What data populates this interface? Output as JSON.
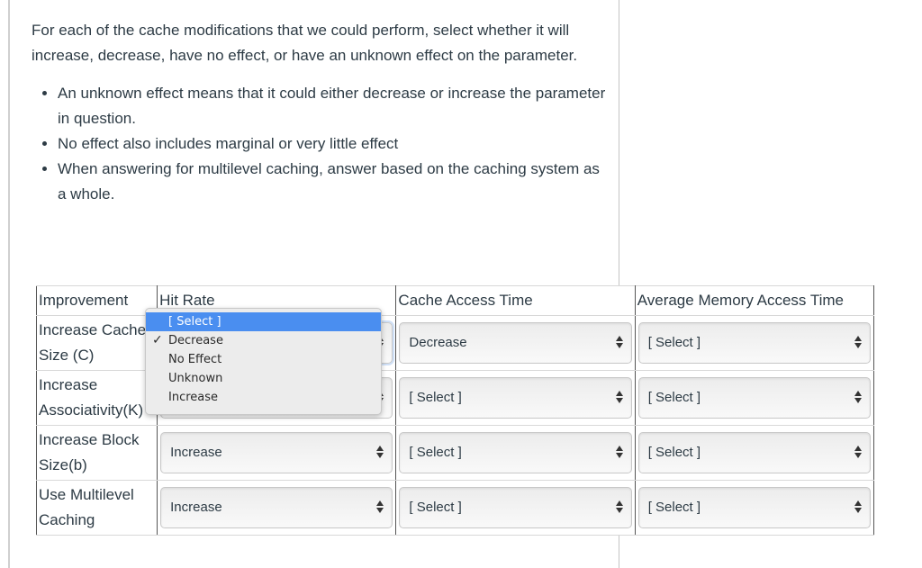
{
  "instructions": {
    "intro": "For each of the cache modifications that we could perform, select whether it will increase, decrease, have no effect, or have an unknown effect on the parameter.",
    "notes": [
      "An unknown effect means that it could either decrease or increase the parameter in question.",
      "No effect also includes marginal or very little effect",
      "When answering for multilevel caching, answer based on the caching system as a whole."
    ]
  },
  "table": {
    "headers": [
      "Improvement",
      "Hit Rate",
      "Cache Access Time",
      "Average Memory Access Time"
    ],
    "rows": [
      {
        "label": "Increase Cache Size (C)",
        "hit_rate": "Decrease",
        "cache_access_time": "Decrease",
        "amat": "[ Select ]"
      },
      {
        "label": "Increase Associativity(K)",
        "hit_rate": "[ Select ]",
        "cache_access_time": "[ Select ]",
        "amat": "[ Select ]"
      },
      {
        "label": "Increase Block Size(b)",
        "hit_rate": "Increase",
        "cache_access_time": "[ Select ]",
        "amat": "[ Select ]"
      },
      {
        "label": "Use Multilevel Caching",
        "hit_rate": "Increase",
        "cache_access_time": "[ Select ]",
        "amat": "[ Select ]"
      }
    ]
  },
  "open_dropdown": {
    "options": [
      "[ Select ]",
      "Decrease",
      "No Effect",
      "Unknown",
      "Increase"
    ],
    "highlighted": "[ Select ]",
    "checked": "Decrease",
    "check_glyph": "✓"
  }
}
